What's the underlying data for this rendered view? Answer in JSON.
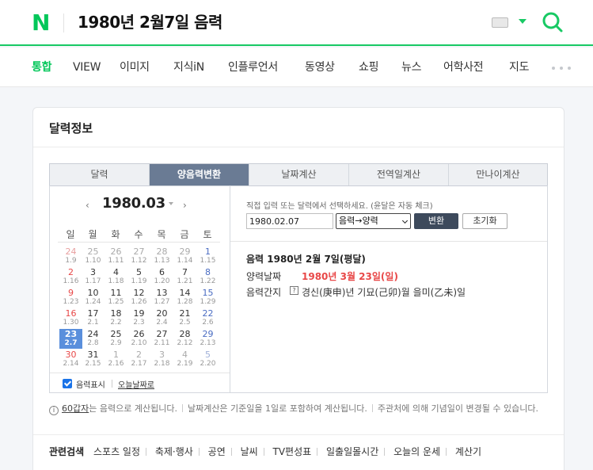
{
  "header": {
    "logo": "N",
    "query": "1980년 2월7일 음력",
    "icons": [
      "keyboard-icon",
      "chevron-down-icon",
      "search-icon"
    ],
    "accent_color": "#03c75a"
  },
  "tabs": [
    {
      "label": "통합",
      "active": true
    },
    {
      "label": "VIEW"
    },
    {
      "label": "이미지"
    },
    {
      "label": "지식iN"
    },
    {
      "label": "인플루언서"
    },
    {
      "label": "동영상"
    },
    {
      "label": "쇼핑"
    },
    {
      "label": "뉴스"
    },
    {
      "label": "어학사전"
    },
    {
      "label": "지도"
    }
  ],
  "card": {
    "title": "달력정보",
    "calendar_tabs": [
      {
        "label": "달력"
      },
      {
        "label": "양음력변환",
        "active": true
      },
      {
        "label": "날짜계산"
      },
      {
        "label": "전역일계산"
      },
      {
        "label": "만나이계산"
      }
    ],
    "calendar": {
      "month": "1980.03",
      "weekdays": [
        "일",
        "월",
        "화",
        "수",
        "목",
        "금",
        "토"
      ],
      "weeks": [
        [
          {
            "d": "24",
            "l": "1.9",
            "o": true
          },
          {
            "d": "25",
            "l": "1.10",
            "o": true
          },
          {
            "d": "26",
            "l": "1.11",
            "o": true
          },
          {
            "d": "27",
            "l": "1.12",
            "o": true
          },
          {
            "d": "28",
            "l": "1.13",
            "o": true
          },
          {
            "d": "29",
            "l": "1.14",
            "o": true
          },
          {
            "d": "1",
            "l": "1.15"
          }
        ],
        [
          {
            "d": "2",
            "l": "1.16"
          },
          {
            "d": "3",
            "l": "1.17"
          },
          {
            "d": "4",
            "l": "1.18"
          },
          {
            "d": "5",
            "l": "1.19"
          },
          {
            "d": "6",
            "l": "1.20"
          },
          {
            "d": "7",
            "l": "1.21"
          },
          {
            "d": "8",
            "l": "1.22"
          }
        ],
        [
          {
            "d": "9",
            "l": "1.23"
          },
          {
            "d": "10",
            "l": "1.24"
          },
          {
            "d": "11",
            "l": "1.25"
          },
          {
            "d": "12",
            "l": "1.26"
          },
          {
            "d": "13",
            "l": "1.27"
          },
          {
            "d": "14",
            "l": "1.28"
          },
          {
            "d": "15",
            "l": "1.29"
          }
        ],
        [
          {
            "d": "16",
            "l": "1.30"
          },
          {
            "d": "17",
            "l": "2.1"
          },
          {
            "d": "18",
            "l": "2.2"
          },
          {
            "d": "19",
            "l": "2.3"
          },
          {
            "d": "20",
            "l": "2.4"
          },
          {
            "d": "21",
            "l": "2.5"
          },
          {
            "d": "22",
            "l": "2.6"
          }
        ],
        [
          {
            "d": "23",
            "l": "2.7",
            "s": true
          },
          {
            "d": "24",
            "l": "2.8"
          },
          {
            "d": "25",
            "l": "2.9"
          },
          {
            "d": "26",
            "l": "2.10"
          },
          {
            "d": "27",
            "l": "2.11"
          },
          {
            "d": "28",
            "l": "2.12"
          },
          {
            "d": "29",
            "l": "2.13"
          }
        ],
        [
          {
            "d": "30",
            "l": "2.14"
          },
          {
            "d": "31",
            "l": "2.15"
          },
          {
            "d": "1",
            "l": "2.16",
            "o": true
          },
          {
            "d": "2",
            "l": "2.17",
            "o": true
          },
          {
            "d": "3",
            "l": "2.18",
            "o": true
          },
          {
            "d": "4",
            "l": "2.19",
            "o": true
          },
          {
            "d": "5",
            "l": "2.20",
            "o": true
          }
        ]
      ],
      "show_lunar_label": "음력표시",
      "today_link": "오늘날짜로"
    },
    "converter": {
      "hint": "직접 입력 또는 달력에서 선택하세요. (윤달은 자동 체크)",
      "input_value": "1980.02.07",
      "mode": "음력→양력",
      "convert_label": "변환",
      "reset_label": "초기화",
      "result_title": "음력 1980년 2월 7일(평달)",
      "solar_label": "양력날짜",
      "solar_value": "1980년 3월 23일(일)",
      "ganji_label": "음력간지",
      "ganji_help": "?",
      "ganji_value": "경신(庚申)년 기묘(己卯)월 을미(乙未)일"
    },
    "notes": {
      "link": "60갑자",
      "n1": "는 음력으로 계산됩니다.",
      "n2": "날짜계산은 기준일을 1일로 포함하여 계산됩니다.",
      "n3": "주관처에 의해 기념일이 변경될 수 있습니다."
    },
    "related": {
      "title": "관련검색",
      "items": [
        "스포츠 일정",
        "축제·행사",
        "공연",
        "날씨",
        "TV편성표",
        "일출일몰시간",
        "오늘의 운세",
        "계산기"
      ]
    }
  }
}
